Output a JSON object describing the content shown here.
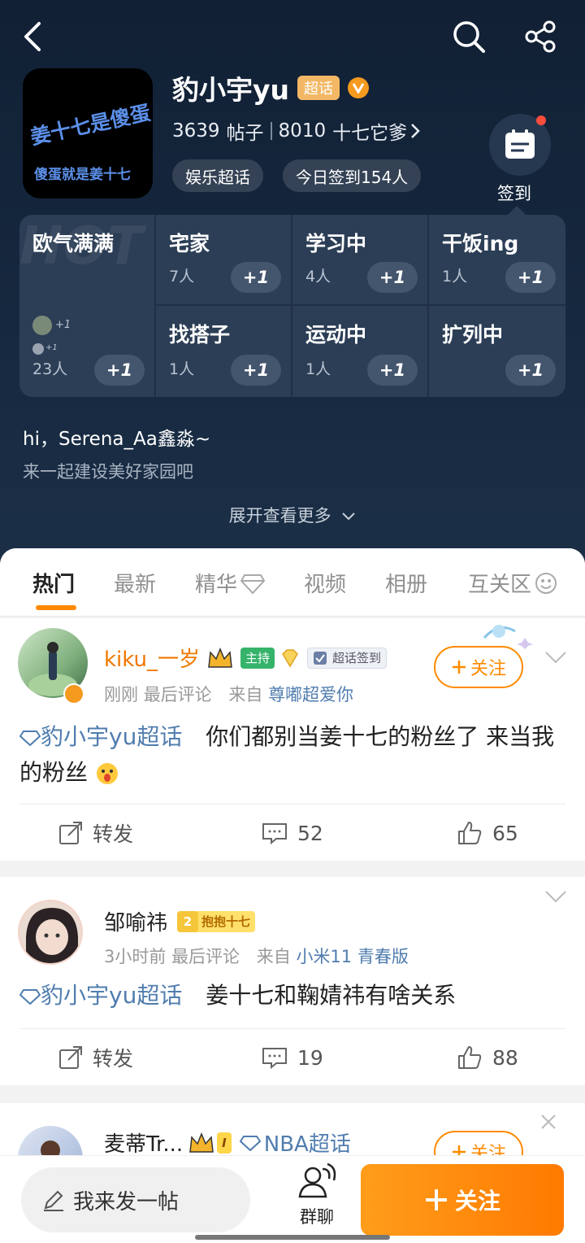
{
  "header": {
    "title": "豹小宇yu",
    "badge": "超话",
    "avatar_lines": [
      "姜十七是傻蛋",
      "傻蛋就是姜十七"
    ],
    "posts_count": "3639",
    "posts_label": "帖子",
    "fans_count": "8010",
    "fans_label": "十七它爹",
    "category_pill": "娱乐超话",
    "checkin_pill": "今日签到154人",
    "checkin_label": "签到"
  },
  "status_grid": {
    "watermark": "HOT",
    "plus_label": "+1",
    "big_cell": {
      "title": "欧气满满",
      "count": "23人",
      "mini_plus": [
        "+1",
        "+1"
      ]
    },
    "cells": [
      {
        "title": "宅家",
        "count": "7人"
      },
      {
        "title": "学习中",
        "count": "4人"
      },
      {
        "title": "干饭ing",
        "count": "1人"
      },
      {
        "title": "找搭子",
        "count": "1人"
      },
      {
        "title": "运动中",
        "count": "1人"
      },
      {
        "title": "扩列中",
        "count": ""
      }
    ]
  },
  "greeting": {
    "line1": "hi，Serena_Aa鑫淼~",
    "line2": "来一起建设美好家园吧",
    "expand": "展开查看更多"
  },
  "tabs": [
    "热门",
    "最新",
    "精华",
    "视频",
    "相册",
    "互关区"
  ],
  "posts": [
    {
      "name": "kiku_一岁",
      "tags": [
        "主持",
        "超话签到"
      ],
      "time": "刚刚",
      "last_comment": "最后评论",
      "from_prefix": "来自",
      "source": "尊嘟超爱你",
      "topic": "豹小宇yu超话",
      "text": "你们都别当姜十七的粉丝了 来当我的粉丝",
      "follow": "关注",
      "repost": "转发",
      "comments": "52",
      "likes": "65"
    },
    {
      "name": "邹喻祎",
      "level": "2",
      "fan_tag": "抱抱十七",
      "time": "3小时前",
      "last_comment": "最后评论",
      "from_prefix": "来自",
      "source": "小米11 青春版",
      "topic": "豹小宇yu超话",
      "text": "姜十七和鞠婧祎有啥关系",
      "repost": "转发",
      "comments": "19",
      "likes": "88"
    },
    {
      "name": "麦蒂Tr...",
      "level": "I",
      "topic": "NBA超话",
      "follow": "关注"
    }
  ],
  "bottom_bar": {
    "compose": "我来发一帖",
    "group_chat": "群聊",
    "follow": "关注"
  },
  "colors": {
    "accent": "#ff8a00",
    "link": "#507daf",
    "header_bg": "#16283f"
  }
}
